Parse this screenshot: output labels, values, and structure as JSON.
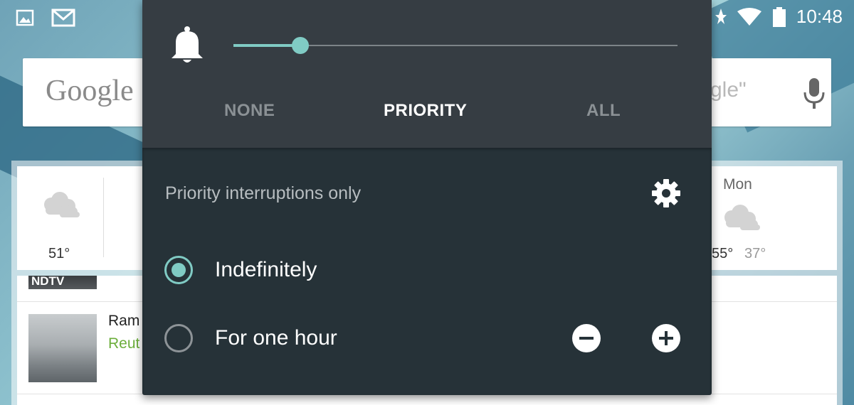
{
  "status_bar": {
    "left_icons": [
      "image-icon",
      "gmail-icon"
    ],
    "right_icons": [
      "star-icon",
      "wifi-icon",
      "battery-icon"
    ],
    "time": "10:48"
  },
  "search": {
    "logo": "Google",
    "hint_fragment": "gle\"",
    "mic_icon": "mic-icon"
  },
  "weather": {
    "current_temp": "51°",
    "day": "Mon",
    "high": "55°",
    "low": "37°"
  },
  "news": {
    "top_source": "NDTV",
    "item_title": "Ram",
    "item_source": "Reut"
  },
  "interruptions": {
    "slider_position": 0.15,
    "modes": [
      "NONE",
      "PRIORITY",
      "ALL"
    ],
    "selected_mode": "PRIORITY",
    "heading": "Priority interruptions only",
    "options": [
      {
        "label": "Indefinitely",
        "selected": true
      },
      {
        "label": "For one hour",
        "selected": false
      }
    ],
    "accent_color": "#80cbc4"
  }
}
